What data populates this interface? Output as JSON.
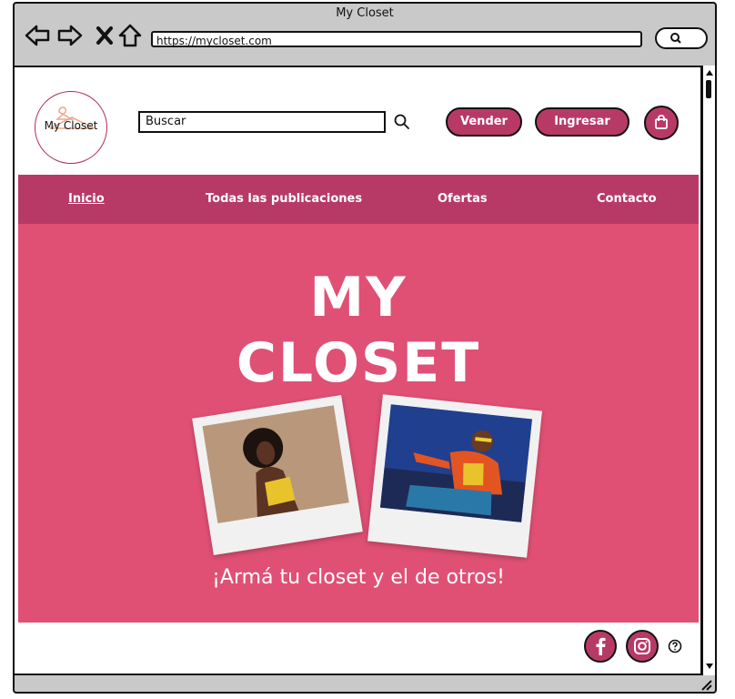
{
  "window": {
    "title": "My Closet",
    "url": "https://mycloset.com"
  },
  "header": {
    "logo_text": "My Closet",
    "search_value": "Buscar",
    "buttons": {
      "sell": "Vender",
      "login": "Ingresar"
    }
  },
  "nav": {
    "items": [
      {
        "label": "Inicio",
        "active": true
      },
      {
        "label": "Todas las publicaciones",
        "active": false
      },
      {
        "label": "Ofertas",
        "active": false
      },
      {
        "label": "Contacto",
        "active": false
      }
    ]
  },
  "hero": {
    "title_line1": "MY",
    "title_line2": "CLOSET",
    "tagline": "¡Armá tu closet y el de otros!"
  },
  "icons": {
    "back": "arrow-left-icon",
    "forward": "arrow-right-icon",
    "stop": "close-icon",
    "home": "home-icon",
    "search": "search-icon",
    "cart": "shopping-bag-icon",
    "facebook": "facebook-icon",
    "instagram": "instagram-icon",
    "help": "help-icon"
  },
  "colors": {
    "accent": "#b73a66",
    "hero": "#e05075",
    "text_light": "#ffffff"
  }
}
